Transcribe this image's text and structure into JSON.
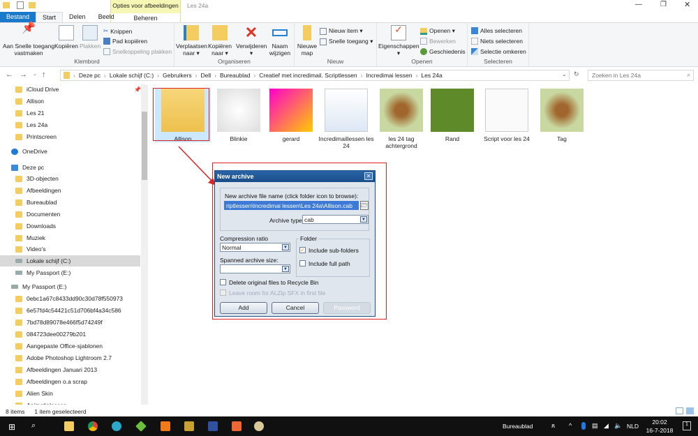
{
  "window": {
    "title": "Les 24a",
    "context_tab": "Opties voor afbeeldingen",
    "context_sub": "Beheren"
  },
  "tabs": [
    "Bestand",
    "Start",
    "Delen",
    "Beeld"
  ],
  "ribbon": {
    "klembord": {
      "label": "Klembord",
      "pin": "Aan Snelle toegang vastmaken",
      "copy": "Kopiëren",
      "paste": "Plakken",
      "cut": "Knippen",
      "copy_path": "Pad kopiëren",
      "paste_shortcut": "Snelkoppeling plakken"
    },
    "organiseren": {
      "label": "Organiseren",
      "move": "Verplaatsen naar ▾",
      "copy_to": "Kopiëren naar ▾",
      "delete": "Verwijderen ▾",
      "rename": "Naam wijzigen"
    },
    "nieuw": {
      "label": "Nieuw",
      "new_folder": "Nieuwe map",
      "new_item": "Nieuw item ▾",
      "quick_access": "Snelle toegang ▾"
    },
    "openen": {
      "label": "Openen",
      "properties": "Eigenschappen ▾",
      "open": "Openen ▾",
      "edit": "Bewerken",
      "history": "Geschiedenis"
    },
    "selecteren": {
      "label": "Selecteren",
      "all": "Alles selecteren",
      "none": "Niets selecteren",
      "invert": "Selectie omkeren"
    }
  },
  "address": {
    "path": [
      "Deze pc",
      "Lokale schijf (C:)",
      "Gebruikers",
      "Dell",
      "Bureaublad",
      "Creatief met incredimail. Scriptlessen",
      "Incredimai lessen",
      "Les 24a"
    ],
    "search_placeholder": "Zoeken in Les 24a"
  },
  "sidebar": [
    {
      "label": "iCloud Drive",
      "type": "folder"
    },
    {
      "label": "Allison",
      "type": "folder"
    },
    {
      "label": "Les 21",
      "type": "folder"
    },
    {
      "label": "Les 24a",
      "type": "folder"
    },
    {
      "label": "Printscreen",
      "type": "folder"
    },
    {
      "label": "OneDrive",
      "type": "cloud"
    },
    {
      "label": "Deze pc",
      "type": "pc"
    },
    {
      "label": "3D-objecten",
      "type": "folder"
    },
    {
      "label": "Afbeeldingen",
      "type": "folder"
    },
    {
      "label": "Bureaublad",
      "type": "folder"
    },
    {
      "label": "Documenten",
      "type": "folder"
    },
    {
      "label": "Downloads",
      "type": "folder"
    },
    {
      "label": "Muziek",
      "type": "folder"
    },
    {
      "label": "Video's",
      "type": "folder"
    },
    {
      "label": "Lokale schijf (C:)",
      "type": "drive",
      "selected": true
    },
    {
      "label": "My Passport (E:)",
      "type": "drive"
    },
    {
      "label": "My Passport (E:)",
      "type": "drive"
    },
    {
      "label": "0ebc1a67c8433dd90c30d78f550973",
      "type": "folder"
    },
    {
      "label": "6e57fd4c54421c51d706bf4a34c586",
      "type": "folder"
    },
    {
      "label": "7bd78d89078e466f5d74249f",
      "type": "folder"
    },
    {
      "label": "084723dee00279b201",
      "type": "folder"
    },
    {
      "label": "Aangepaste Office-sjablonen",
      "type": "folder"
    },
    {
      "label": "Adobe Photoshop Lightroom 2.7",
      "type": "folder"
    },
    {
      "label": "Afbeeldingen Januari 2013",
      "type": "folder"
    },
    {
      "label": "Afbeeldingen o.a scrap",
      "type": "folder"
    },
    {
      "label": "Alien Skin",
      "type": "folder"
    },
    {
      "label": "Animatielessen",
      "type": "folder"
    }
  ],
  "files": [
    {
      "name": "Allison",
      "kind": "folder"
    },
    {
      "name": "Blinkie",
      "kind": "dove"
    },
    {
      "name": "gerard",
      "kind": "app"
    },
    {
      "name": "Incredimaillessen les 24",
      "kind": "doc"
    },
    {
      "name": "les 24 tag achtergrond",
      "kind": "img"
    },
    {
      "name": "Rand",
      "kind": "green"
    },
    {
      "name": "Script voor les 24",
      "kind": "txt"
    },
    {
      "name": "Tag",
      "kind": "img"
    }
  ],
  "status": {
    "count": "8 items",
    "selected": "1 item geselecteerd"
  },
  "dialog": {
    "title": "New archive",
    "file_label": "New archive file name (click folder icon to browse):",
    "file_value": "riptlessen\\Incredimai lessen\\Les 24a\\Allison.cab",
    "type_label": "Archive type",
    "type_value": "cab",
    "ratio_label": "Compression ratio",
    "ratio_value": "Normal",
    "span_label": "Spanned archive size:",
    "span_value": "",
    "folder_label": "Folder",
    "sub_folders": "Include sub-folders",
    "sub_folders_checked": true,
    "full_path": "Include full path",
    "full_path_checked": false,
    "delete_orig": "Delete original files to Recycle Bin",
    "leave_room": "Leave room for ALZip SFX in first file",
    "add": "Add",
    "cancel": "Cancel",
    "password": "Password"
  },
  "taskbar": {
    "location": "Bureaublad",
    "lang": "NLD",
    "time": "20:02",
    "date": "16-7-2018",
    "notifications": "1"
  }
}
